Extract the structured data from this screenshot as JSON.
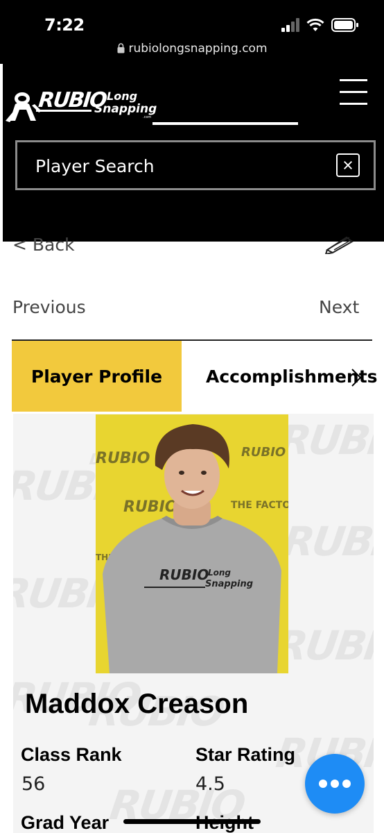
{
  "status_bar": {
    "time": "7:22",
    "icons": [
      "cellular-signal-icon",
      "wifi-icon",
      "battery-icon"
    ]
  },
  "browser": {
    "url": "rubiolongsnapping.com",
    "lock_icon": "lock-icon"
  },
  "site_header": {
    "logo_wordmark": "RUBIO Long Snapping",
    "menu_icon": "hamburger-menu-icon",
    "search": {
      "placeholder": "Player Search",
      "close_icon": "close-icon"
    }
  },
  "nav": {
    "back_label": "< Back",
    "edit_icon": "pencil-icon",
    "previous_label": "Previous",
    "next_label": "Next"
  },
  "tabs": [
    {
      "label": "Player Profile",
      "active": true
    },
    {
      "label": "Accomplishments",
      "active": false
    }
  ],
  "tab_scroll_icon": "chevron-right-icon",
  "player": {
    "name": "Maddox Creason",
    "stats": [
      {
        "label": "Class Rank",
        "value": "56"
      },
      {
        "label": "Star Rating",
        "value": "4.5"
      },
      {
        "label": "Grad Year",
        "value": ""
      },
      {
        "label": "Height",
        "value": ""
      }
    ]
  },
  "fab": {
    "icon": "more-dots-icon"
  },
  "colors": {
    "accent_yellow": "#f2c93d",
    "fab_blue": "#1e8cf5",
    "header_black": "#000000"
  }
}
